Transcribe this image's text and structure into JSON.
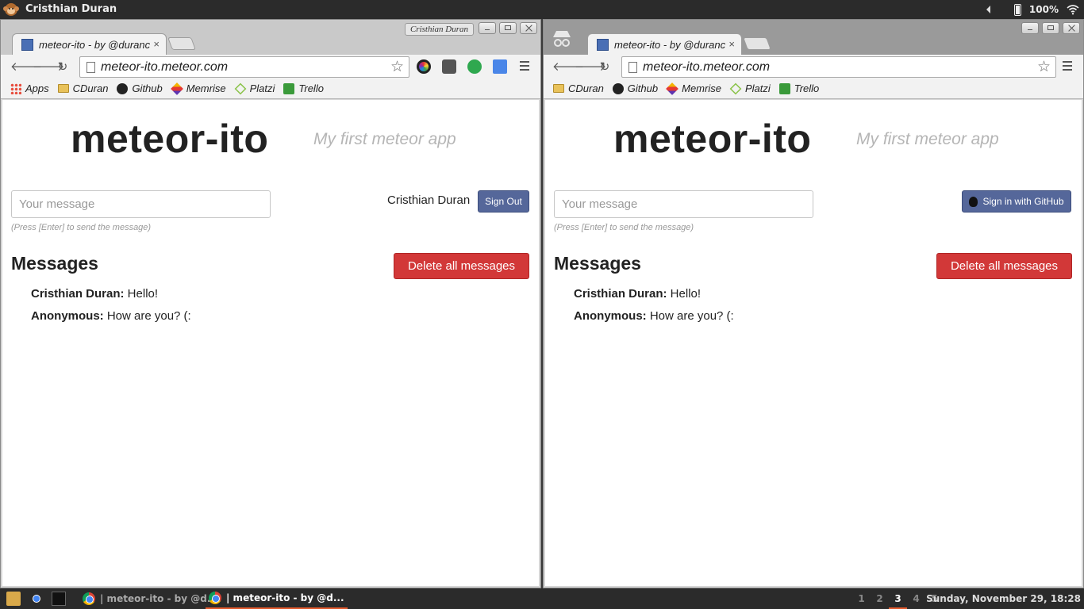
{
  "top_panel": {
    "user_name": "Cristhian Duran",
    "battery": "100%"
  },
  "left_window": {
    "profile_badge": "Cristhian Duran",
    "tab": {
      "title": "meteor-ito - by @duranc",
      "close": "×"
    },
    "url": "meteor-ito.meteor.com",
    "bookmarks": [
      "Apps",
      "CDuran",
      "Github",
      "Memrise",
      "Platzi",
      "Trello"
    ]
  },
  "right_window": {
    "tab": {
      "title": "meteor-ito - by @duranc",
      "close": "×"
    },
    "url": "meteor-ito.meteor.com",
    "bookmarks": [
      "CDuran",
      "Github",
      "Memrise",
      "Platzi",
      "Trello"
    ]
  },
  "app": {
    "title": "meteor-ito",
    "subtitle": "My first meteor app",
    "input_placeholder": "Your message",
    "hint": "(Press [Enter] to send the message)",
    "messages_heading": "Messages",
    "delete_label": "Delete all messages",
    "messages": [
      {
        "author": "Cristhian Duran:",
        "text": " Hello!"
      },
      {
        "author": "Anonymous:",
        "text": " How are you? (:"
      }
    ]
  },
  "left_auth": {
    "user": "Cristhian Duran",
    "sign_out_label": "Sign Out"
  },
  "right_auth": {
    "sign_in_label": "Sign in with GitHub"
  },
  "taskbar": {
    "tasks": [
      "| meteor-ito - by @d...",
      "| meteor-ito - by @d..."
    ],
    "workspaces": [
      "1",
      "2",
      "3",
      "4",
      "5"
    ],
    "current_workspace": "3",
    "clock": "Sunday, November 29, 18:28"
  },
  "colors": {
    "accent_red": "#d23838",
    "button_blue": "#55679a",
    "panel_dark": "#2b2b2b",
    "active_underline": "#e35a2d"
  }
}
